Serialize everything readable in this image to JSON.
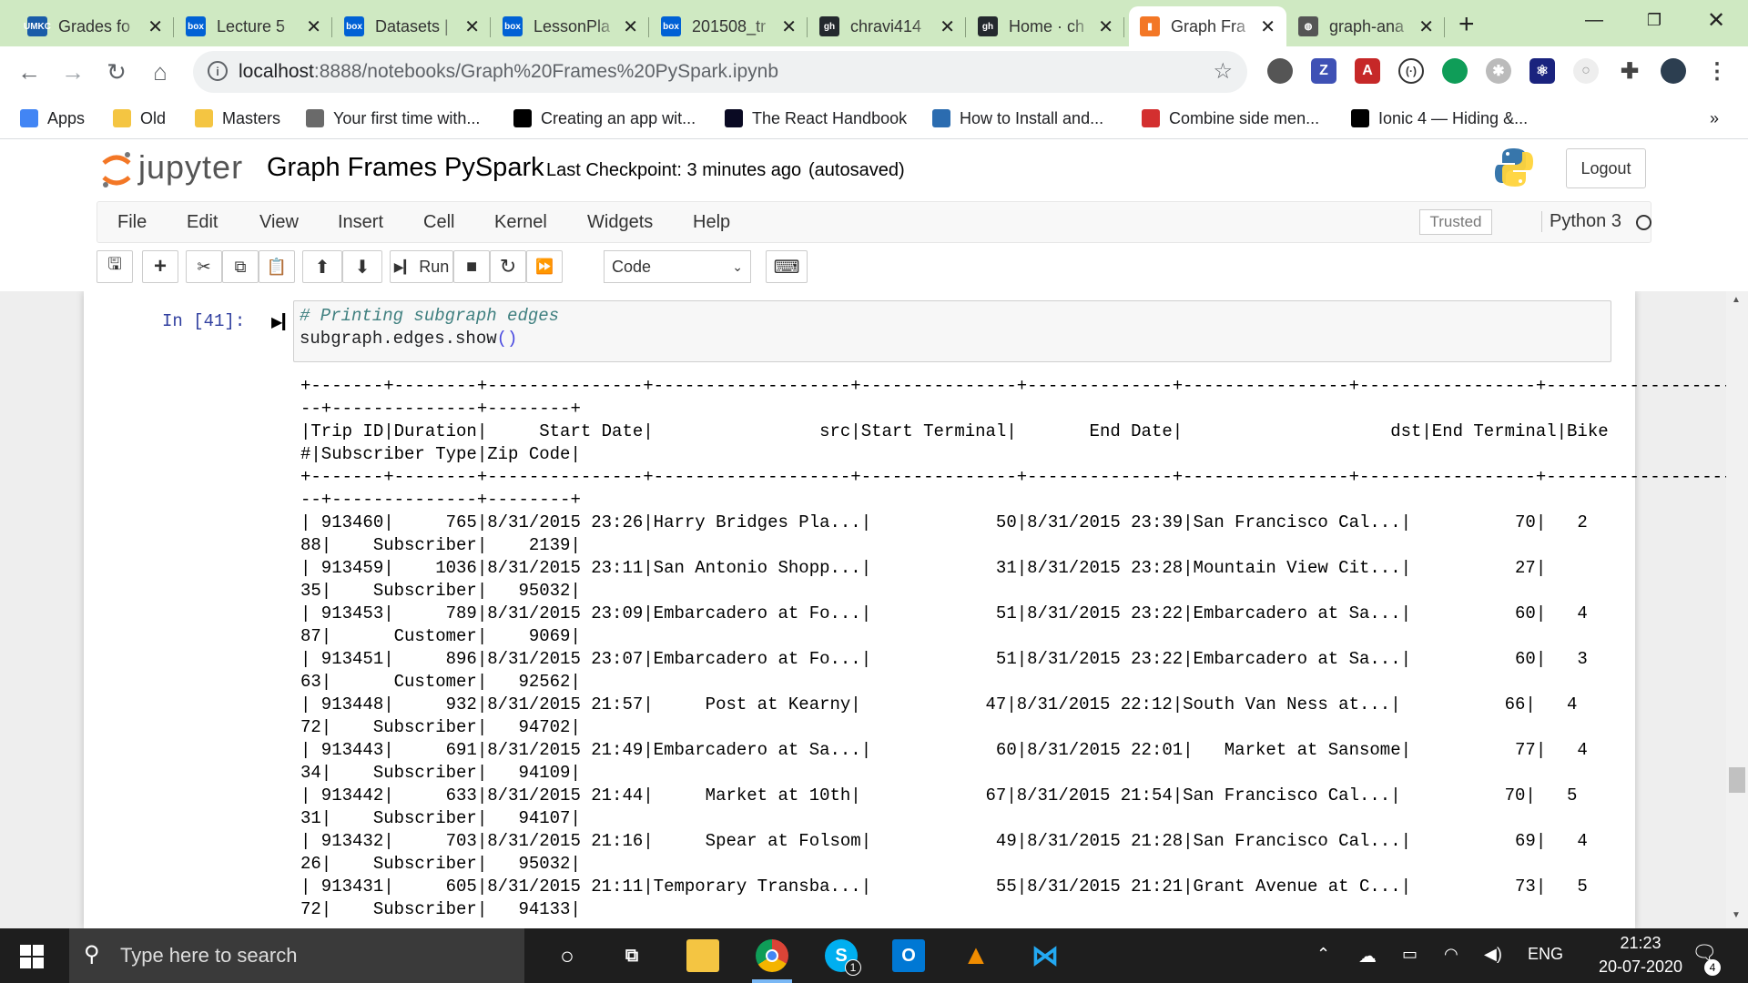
{
  "browser": {
    "tabs": [
      {
        "title": "Grades fo",
        "icon": "umkc-icon",
        "color": "#1a5ca8",
        "glyph": "UMKC"
      },
      {
        "title": "Lecture 5",
        "icon": "box-icon",
        "color": "#0061d5",
        "glyph": "box"
      },
      {
        "title": "Datasets |",
        "icon": "box-icon",
        "color": "#0061d5",
        "glyph": "box"
      },
      {
        "title": "LessonPla",
        "icon": "box-icon",
        "color": "#0061d5",
        "glyph": "box"
      },
      {
        "title": "201508_tr",
        "icon": "box-icon",
        "color": "#0061d5",
        "glyph": "box"
      },
      {
        "title": "chravi414",
        "icon": "github-icon",
        "color": "#24292e",
        "glyph": "gh"
      },
      {
        "title": "Home · ch",
        "icon": "github-icon",
        "color": "#24292e",
        "glyph": "gh"
      },
      {
        "title": "Graph Fra",
        "icon": "jupyter-icon",
        "color": "#f37726",
        "glyph": "▮",
        "active": true
      },
      {
        "title": "graph-ana",
        "icon": "globe-icon",
        "color": "#555555",
        "glyph": "◍"
      }
    ],
    "new_tab": "+",
    "url_host": "localhost",
    "url_path": ":8888/notebooks/Graph%20Frames%20PySpark.ipynb",
    "bookmarks": [
      {
        "label": "Apps",
        "icon": "apps-grid-icon",
        "color": "#4285f4"
      },
      {
        "label": "Old",
        "icon": "folder-icon",
        "color": "#f4c542"
      },
      {
        "label": "Masters",
        "icon": "folder-icon",
        "color": "#f4c542"
      },
      {
        "label": "Your first time with...",
        "icon": "person-icon",
        "color": "#6a6a6a"
      },
      {
        "label": "Creating an app wit...",
        "icon": "dev-icon",
        "color": "#000000"
      },
      {
        "label": "The React Handbook",
        "icon": "freecodecamp-icon",
        "color": "#0a0a23"
      },
      {
        "label": "How to Install and...",
        "icon": "react-icon",
        "color": "#2b6cb0"
      },
      {
        "label": "Combine side men...",
        "icon": "dots-icon",
        "color": "#d32f2f"
      },
      {
        "label": "Ionic 4 — Hiding &...",
        "icon": "medium-icon",
        "color": "#000000"
      }
    ],
    "more_bookmarks": "»"
  },
  "jupyter": {
    "logo_text": "jupyter",
    "notebook_title": "Graph Frames PySpark",
    "checkpoint": "Last Checkpoint: 3 minutes ago",
    "autosaved": "(autosaved)",
    "logout": "Logout",
    "menus": [
      "File",
      "Edit",
      "View",
      "Insert",
      "Cell",
      "Kernel",
      "Widgets",
      "Help"
    ],
    "trusted": "Trusted",
    "kernel": "Python 3",
    "run_label": "Run",
    "cell_type": "Code"
  },
  "cell": {
    "prompt": "In [41]:",
    "code_comment": "# Printing subgraph edges",
    "code_line": "subgraph.edges.show",
    "code_parens": "()",
    "output_lines": [
      "+-------+--------+---------------+-------------------+---------------+--------------+----------------+-----------------+---------------------+----",
      "--+--------------+--------+",
      "|Trip ID|Duration|     Start Date|                src|Start Terminal|       End Date|                    dst|End Terminal|Bike",
      "#|Subscriber Type|Zip Code|",
      "+-------+--------+---------------+-------------------+---------------+--------------+----------------+-----------------+---------------------+----",
      "--+--------------+--------+",
      "| 913460|     765|8/31/2015 23:26|Harry Bridges Pla...|            50|8/31/2015 23:39|San Francisco Cal...|          70|   2",
      "88|    Subscriber|    2139|",
      "| 913459|    1036|8/31/2015 23:11|San Antonio Shopp...|            31|8/31/2015 23:28|Mountain View Cit...|          27|",
      "35|    Subscriber|   95032|",
      "| 913453|     789|8/31/2015 23:09|Embarcadero at Fo...|            51|8/31/2015 23:22|Embarcadero at Sa...|          60|   4",
      "87|      Customer|    9069|",
      "| 913451|     896|8/31/2015 23:07|Embarcadero at Fo...|            51|8/31/2015 23:22|Embarcadero at Sa...|          60|   3",
      "63|      Customer|   92562|",
      "| 913448|     932|8/31/2015 21:57|     Post at Kearny|            47|8/31/2015 22:12|South Van Ness at...|          66|   4",
      "72|    Subscriber|   94702|",
      "| 913443|     691|8/31/2015 21:49|Embarcadero at Sa...|            60|8/31/2015 22:01|   Market at Sansome|          77|   4",
      "34|    Subscriber|   94109|",
      "| 913442|     633|8/31/2015 21:44|     Market at 10th|            67|8/31/2015 21:54|San Francisco Cal...|          70|   5",
      "31|    Subscriber|   94107|",
      "| 913432|     703|8/31/2015 21:16|     Spear at Folsom|            49|8/31/2015 21:28|San Francisco Cal...|          69|   4",
      "26|    Subscriber|   95032|",
      "| 913431|     605|8/31/2015 21:11|Temporary Transba...|            55|8/31/2015 21:21|Grant Avenue at C...|          73|   5",
      "72|    Subscriber|   94133|"
    ]
  },
  "taskbar": {
    "search_placeholder": "Type here to search",
    "language": "ENG",
    "time": "21:23",
    "date": "20-07-2020",
    "notification_count": "4",
    "skype_badge": "1"
  }
}
